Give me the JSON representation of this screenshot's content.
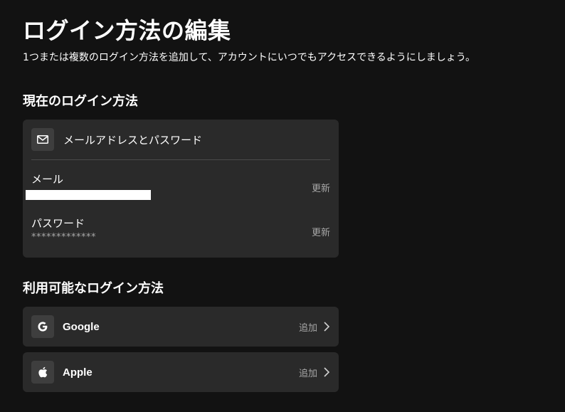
{
  "header": {
    "title": "ログイン方法の編集",
    "subtitle": "1つまたは複数のログイン方法を追加して、アカウントにいつでもアクセスできるようにしましょう。"
  },
  "current": {
    "heading": "現在のログイン方法",
    "method_label": "メールアドレスとパスワード",
    "method_icon": "mail-icon",
    "email": {
      "label": "メール",
      "action": "更新"
    },
    "password": {
      "label": "パスワード",
      "value": "*************",
      "action": "更新"
    }
  },
  "available": {
    "heading": "利用可能なログイン方法",
    "items": [
      {
        "label": "Google",
        "icon": "google-icon",
        "action": "追加"
      },
      {
        "label": "Apple",
        "icon": "apple-icon",
        "action": "追加"
      }
    ]
  },
  "colors": {
    "background": "#121212",
    "card": "#2a2a2a",
    "icon_box": "#3e3e3e",
    "muted_text": "#a7a7a7",
    "text": "#ffffff"
  }
}
